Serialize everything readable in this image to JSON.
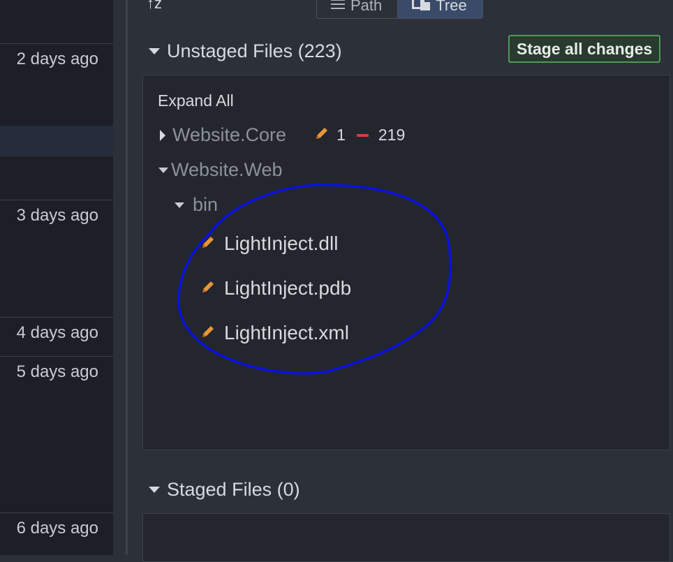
{
  "history": {
    "times": [
      "2 days ago",
      "3 days ago",
      "4 days ago",
      "5 days ago",
      "6 days ago"
    ]
  },
  "toolbar": {
    "sort_label": "↑z",
    "path_label": "Path",
    "tree_label": "Tree"
  },
  "unstaged": {
    "title": "Unstaged Files (223)",
    "stage_all_label": "Stage all changes",
    "expand_all_label": "Expand All",
    "folders": [
      {
        "name": "Website.Core",
        "modified": "1",
        "deleted": "219"
      },
      {
        "name": "Website.Web"
      }
    ],
    "subfolder": "bin",
    "files": [
      "LightInject.dll",
      "LightInject.pdb",
      "LightInject.xml"
    ]
  },
  "staged": {
    "title": "Staged Files (0)"
  },
  "colors": {
    "modified": "#e8953a",
    "deleted": "#d13f3f",
    "stage_border": "#4e9a57",
    "annotation": "#0a10e0"
  },
  "icons": {
    "modified": "pencil-icon",
    "deleted": "minus-icon"
  }
}
